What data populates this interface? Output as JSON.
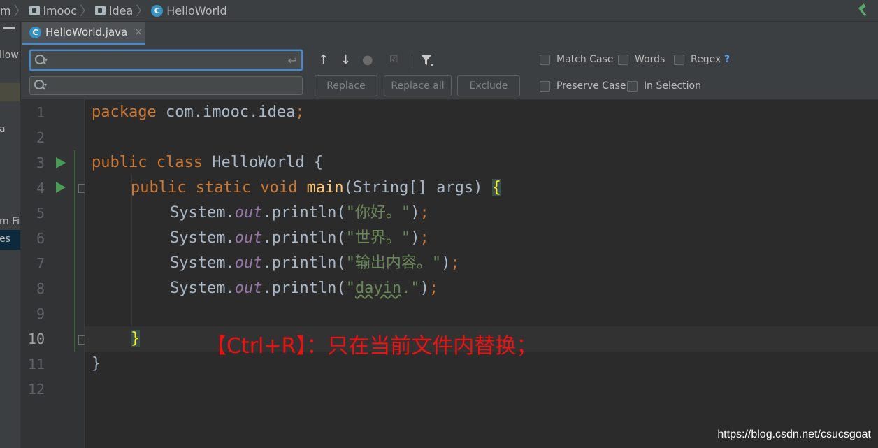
{
  "breadcrumb": {
    "items": [
      "m",
      "imooc",
      "idea",
      "HelloWorld"
    ]
  },
  "left_strip": {
    "texts": [
      "llow",
      "a",
      "m Fil",
      "es"
    ]
  },
  "tab": {
    "label": "HelloWorld.java",
    "close": "×"
  },
  "find": {
    "search_value": "",
    "replace_value": "",
    "buttons": {
      "replace": "Replace",
      "replace_all": "Replace all",
      "exclude": "Exclude"
    },
    "options": {
      "match_case": "Match Case",
      "words": "Words",
      "regex": "Regex",
      "regex_help": "?",
      "preserve_case": "Preserve Case",
      "in_selection": "In Selection"
    }
  },
  "code": {
    "line_numbers": [
      "1",
      "2",
      "3",
      "4",
      "5",
      "6",
      "7",
      "8",
      "9",
      "10",
      "11",
      "12"
    ],
    "l1_kw": "package",
    "l1_rest": " com.imooc.idea",
    "l1_semi": ";",
    "l3_kw": "public class",
    "l3_rest": " HelloWorld {",
    "l4_kw": "public static void",
    "l4_fn": "main",
    "l4_rest": "(String[] args) ",
    "l4_brace": "{",
    "sys": "System.",
    "out": "out",
    "println": ".println(",
    "s5": "\"你好。\"",
    "s6": "\"世界。\"",
    "s7": "\"输出内容。\"",
    "s8_a": "\"",
    "s8_b": "dayin",
    "s8_c": ".\"",
    "close_paren": ")",
    "semi": ";",
    "l10_brace": "}",
    "l11_brace": "}"
  },
  "annotation": "【Ctrl+R】：只在当前文件内替换；",
  "watermark": "https://blog.csdn.net/csucsgoat",
  "colors": {
    "keyword": "#cc7832",
    "string": "#6a8759",
    "field": "#9876aa",
    "function": "#ffc66d",
    "annotation": "#ee1111"
  }
}
